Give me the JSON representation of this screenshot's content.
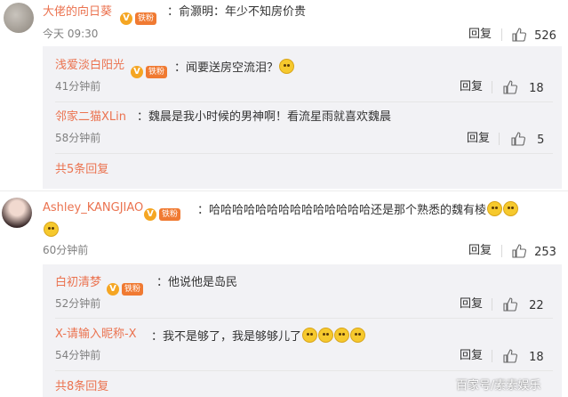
{
  "colors": {
    "accent": "#eb7350",
    "sub_bg": "#f2f2f5",
    "text": "#333333",
    "time": "#808080"
  },
  "actions": {
    "reply": "回复"
  },
  "comments": [
    {
      "user": "大佬的向日葵",
      "badge": "铁粉",
      "text": "：俞灏明：年少不知房价贵",
      "time": "今天 09:30",
      "likes": "526",
      "replies": [
        {
          "user": "浅爱淡白阳光",
          "badge": "铁粉",
          "text": "：闻要送房空流泪？",
          "time": "41分钟前",
          "likes": "18"
        },
        {
          "user": "邻家二猫XLin",
          "text": "：魏晨是我小时候的男神啊！看流星雨就喜欢魏晨",
          "time": "58分钟前",
          "likes": "5"
        }
      ],
      "more": "共5条回复"
    },
    {
      "user": "Ashley_KANGJIAO",
      "badge": "铁粉",
      "text": "：哈哈哈哈哈哈哈哈哈哈哈哈哈哈还是那个熟悉的魏有棱",
      "time": "60分钟前",
      "likes": "253",
      "replies": [
        {
          "user": "白初清梦",
          "badge": "铁粉",
          "text": "：他说他是岛民",
          "time": "52分钟前",
          "likes": "22"
        },
        {
          "user": "X-请输入昵称-X",
          "text": "：我不是够了，我是够够儿了",
          "time": "54分钟前",
          "likes": "18"
        }
      ],
      "more": "共8条回复"
    }
  ],
  "watermark": "百家号/素素娱乐"
}
